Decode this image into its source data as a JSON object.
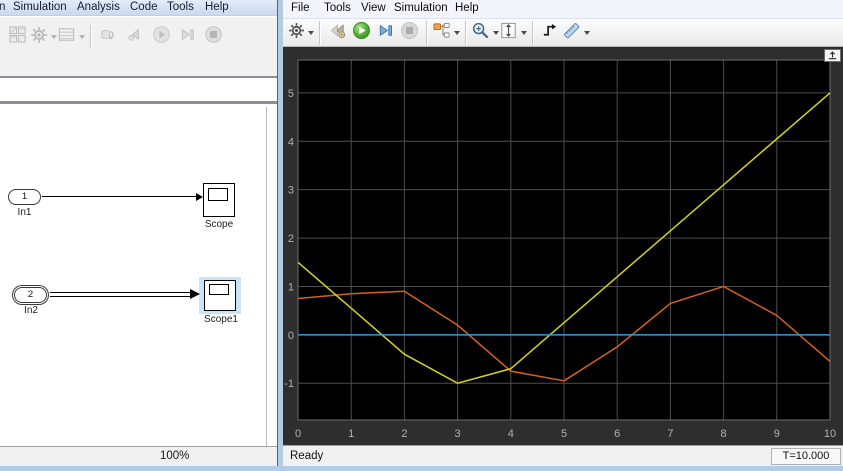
{
  "editor": {
    "menu": [
      "n",
      "Simulation",
      "Analysis",
      "Code",
      "Tools",
      "Help"
    ],
    "toolbar_icons": [
      "window-layout-icon",
      "gear-icon",
      "model-table-icon",
      "update-diagram-icon",
      "step-back-icon",
      "run-icon",
      "step-forward-icon",
      "stop-icon"
    ],
    "blocks": {
      "in1": {
        "port": "1",
        "label": "In1"
      },
      "scope": {
        "label": "Scope"
      },
      "in2": {
        "port": "2",
        "label": "In2"
      },
      "scope1": {
        "label": "Scope1"
      }
    },
    "status": {
      "zoom": "100%"
    }
  },
  "scope_window": {
    "menu": [
      "File",
      "Tools",
      "View",
      "Simulation",
      "Help"
    ],
    "toolbar_icons": [
      "gear-icon",
      "step-back-icon",
      "run-icon",
      "step-forward-icon",
      "stop-icon",
      "signal-selector-icon",
      "zoom-in-icon",
      "fit-to-view-icon",
      "trigger-icon",
      "measurements-icon",
      "dock-icon"
    ],
    "status": {
      "left": "Ready",
      "right": "T=10.000"
    }
  },
  "colors": {
    "window_border": "#b2cce6",
    "selection_highlight": "#cbe3f6",
    "run_button_green": "#4aa02c",
    "step_forward_blue": "#7aabdd"
  },
  "icons": {
    "dropdown_caret": "▾"
  },
  "chart_data": {
    "type": "line",
    "title": "",
    "xlabel": "",
    "ylabel": "",
    "x": [
      0,
      1,
      2,
      3,
      4,
      5,
      6,
      7,
      8,
      9,
      10
    ],
    "series": [
      {
        "name": "signal-orange",
        "color": "#d4611e",
        "values": [
          0.75,
          0.85,
          0.9,
          0.2,
          -0.75,
          -0.95,
          -0.25,
          0.65,
          1.0,
          0.4,
          -0.55
        ]
      },
      {
        "name": "signal-yellow",
        "color": "#d6d21f",
        "values": [
          1.5,
          0.55,
          -0.4,
          -1.0,
          -0.7,
          0.25,
          1.2,
          2.15,
          3.1,
          4.05,
          5.0
        ]
      },
      {
        "name": "signal-zero-blue",
        "color": "#2e9cd6",
        "values": [
          0,
          0,
          0,
          0,
          0,
          0,
          0,
          0,
          0,
          0,
          0
        ]
      }
    ],
    "xlim": [
      0,
      10
    ],
    "ylim": [
      -1.76,
      5.68
    ],
    "xticks": [
      0,
      1,
      2,
      3,
      4,
      5,
      6,
      7,
      8,
      9,
      10
    ],
    "yticks": [
      -1,
      0,
      1,
      2,
      3,
      4,
      5
    ],
    "grid": true,
    "legend": false,
    "bg": "#000000",
    "frame_bg": "#2e2e2e",
    "grid_color": "#4d4d4d",
    "frame_color": "#6e6e6e",
    "tick_color": "#b2b2b2"
  }
}
